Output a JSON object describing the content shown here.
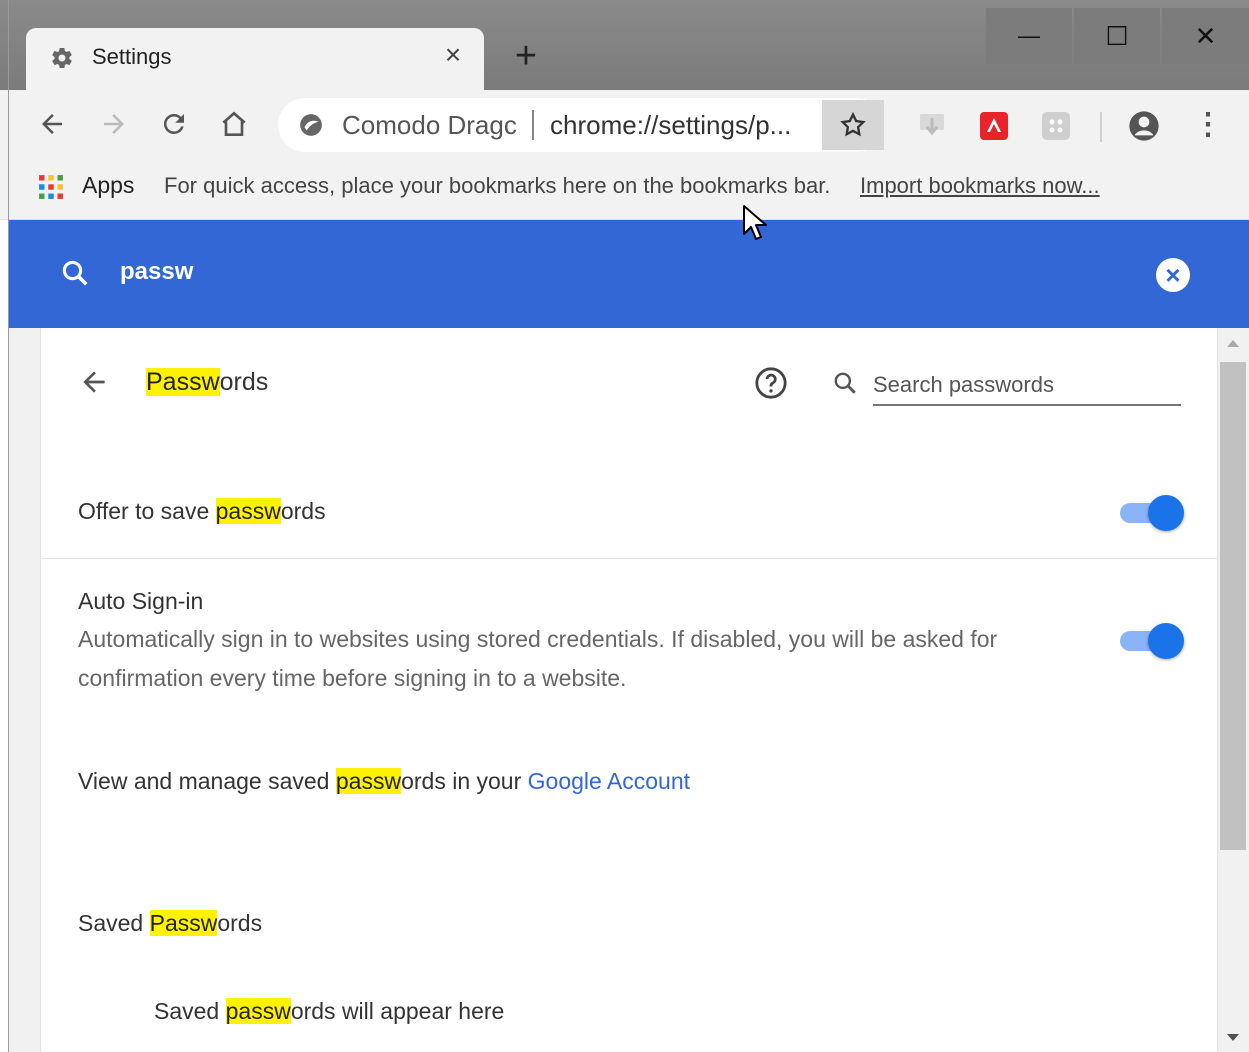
{
  "window": {
    "tab_title": "Settings",
    "tab_close_glyph": "×",
    "new_tab_glyph": "+",
    "minimize_glyph": "—",
    "maximize_glyph": "☐",
    "close_glyph": "✕"
  },
  "toolbar": {
    "site_label": "Comodo Dragc",
    "url": "chrome://settings/p...",
    "icons": [
      "back-icon",
      "forward-icon",
      "reload-icon",
      "home-icon",
      "star-icon",
      "extension-icon",
      "profile-icon",
      "menu-icon"
    ],
    "more_glyph": "⋮"
  },
  "bookmarks": {
    "apps_label": "Apps",
    "hint": "For quick access, place your bookmarks here on the bookmarks bar.",
    "import_link": "Import bookmarks now..."
  },
  "settings_search": {
    "query": "passw",
    "clear_glyph": "×"
  },
  "passwords_page": {
    "title_highlight": "Passw",
    "title_rest": "ords",
    "search_placeholder": "Search passwords",
    "offer_save": {
      "prefix": "Offer to save ",
      "highlight": "passw",
      "suffix": "ords",
      "enabled": true
    },
    "auto_signin": {
      "title": "Auto Sign-in",
      "description": "Automatically sign in to websites using stored credentials. If disabled, you will be asked for confirmation every time before signing in to a website.",
      "enabled": true
    },
    "manage": {
      "prefix": "View and manage saved ",
      "highlight": "passw",
      "middle": "ords in your ",
      "link": "Google Account"
    },
    "saved_heading": {
      "prefix": "Saved ",
      "highlight": "Passw",
      "suffix": "ords"
    },
    "saved_empty": {
      "prefix": "Saved ",
      "highlight": "passw",
      "suffix": "ords will appear here"
    }
  },
  "colors": {
    "accent": "#3367d6",
    "toggle_on": "#1a73e8",
    "highlight": "#fff200"
  }
}
